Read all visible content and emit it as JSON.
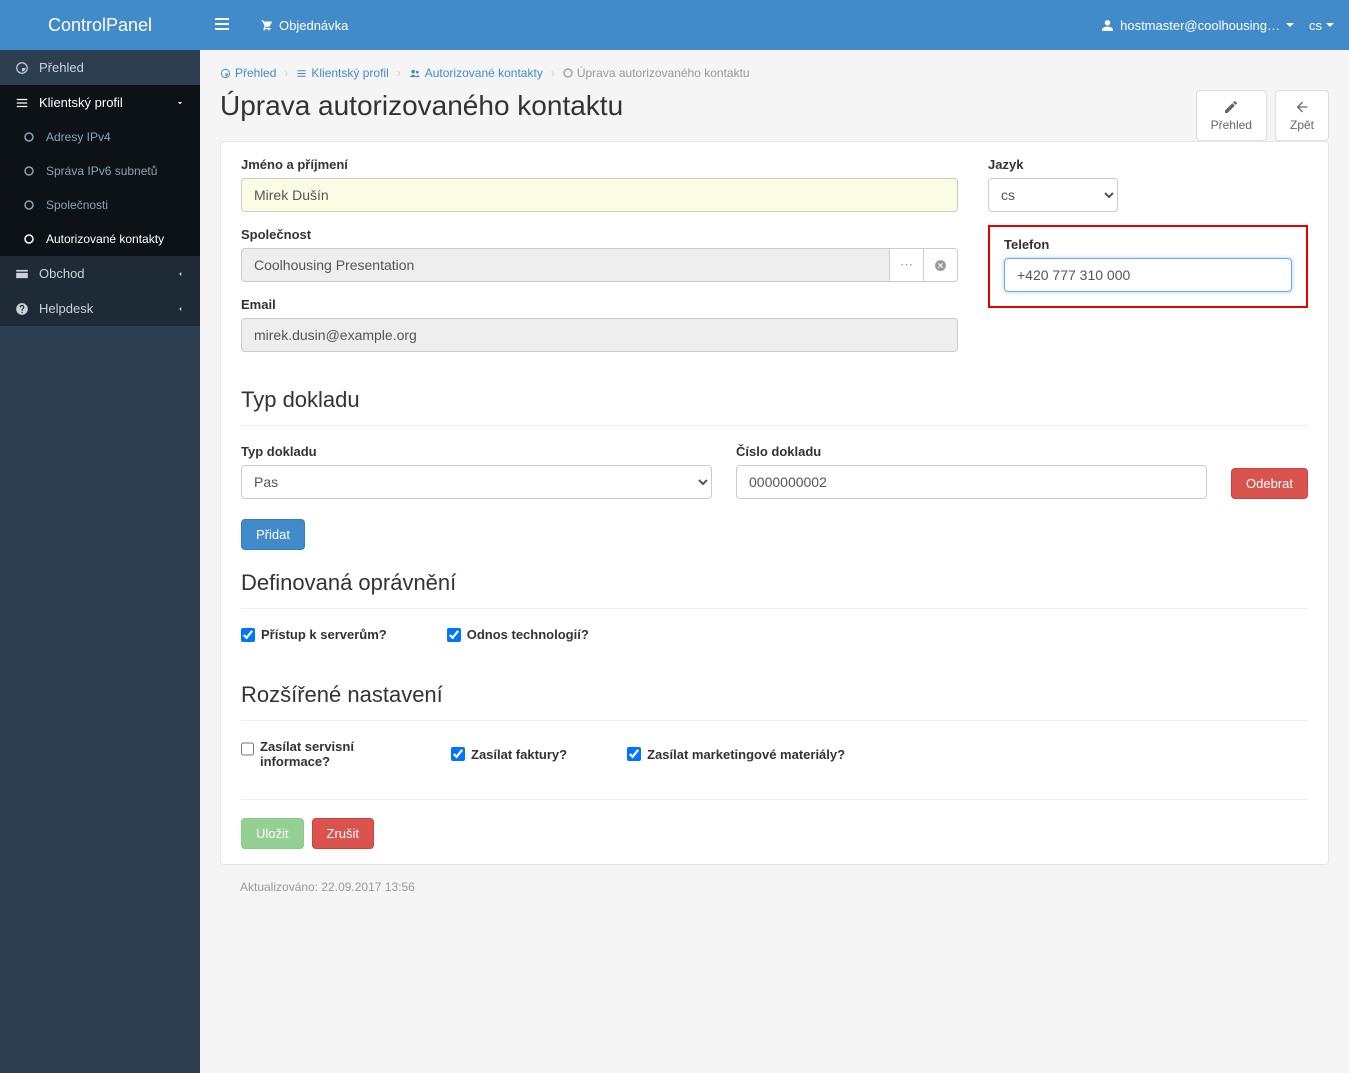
{
  "navbar": {
    "brand": "ControlPanel",
    "order": "Objednávka",
    "user": "hostmaster@coolhousing…",
    "lang": "cs"
  },
  "sidebar": {
    "overview": "Přehled",
    "client_profile": "Klientský profil",
    "sub_ipv4": "Adresy IPv4",
    "sub_ipv6": "Správa IPv6 subnetů",
    "sub_companies": "Společnosti",
    "sub_auth_contacts": "Autorizované kontakty",
    "shop": "Obchod",
    "helpdesk": "Helpdesk"
  },
  "breadcrumb": {
    "overview": "Přehled",
    "client_profile": "Klientský profil",
    "auth_contacts": "Autorizované kontakty",
    "current": "Úprava autorizovaného kontaktu"
  },
  "page": {
    "title": "Úprava autorizovaného kontaktu",
    "btn_overview": "Přehled",
    "btn_back": "Zpět"
  },
  "form": {
    "name_label": "Jméno a příjmení",
    "name_value": "Mirek Dušín",
    "company_label": "Společnost",
    "company_value": "Coolhousing Presentation",
    "email_label": "Email",
    "email_value": "mirek.dusin@example.org",
    "lang_label": "Jazyk",
    "lang_value": "cs",
    "phone_label": "Telefon",
    "phone_value": "+420 777 310 000"
  },
  "section_doc": {
    "heading": "Typ dokladu",
    "type_label": "Typ dokladu",
    "type_value": "Pas",
    "num_label": "Číslo dokladu",
    "num_value": "0000000002",
    "remove": "Odebrat",
    "add": "Přidat"
  },
  "section_perm": {
    "heading": "Definovaná oprávnění",
    "check_servers": "Přístup k serverům?",
    "check_tech": "Odnos technologií?"
  },
  "section_ext": {
    "heading": "Rozšířené nastavení",
    "check_service": "Zasílat servisní informace?",
    "check_invoice": "Zasílat faktury?",
    "check_marketing": "Zasílat marketingové materiály?"
  },
  "actions": {
    "save": "Uložit",
    "cancel": "Zrušit"
  },
  "footer": {
    "updated": "Aktualizováno: 22.09.2017 13:56"
  }
}
